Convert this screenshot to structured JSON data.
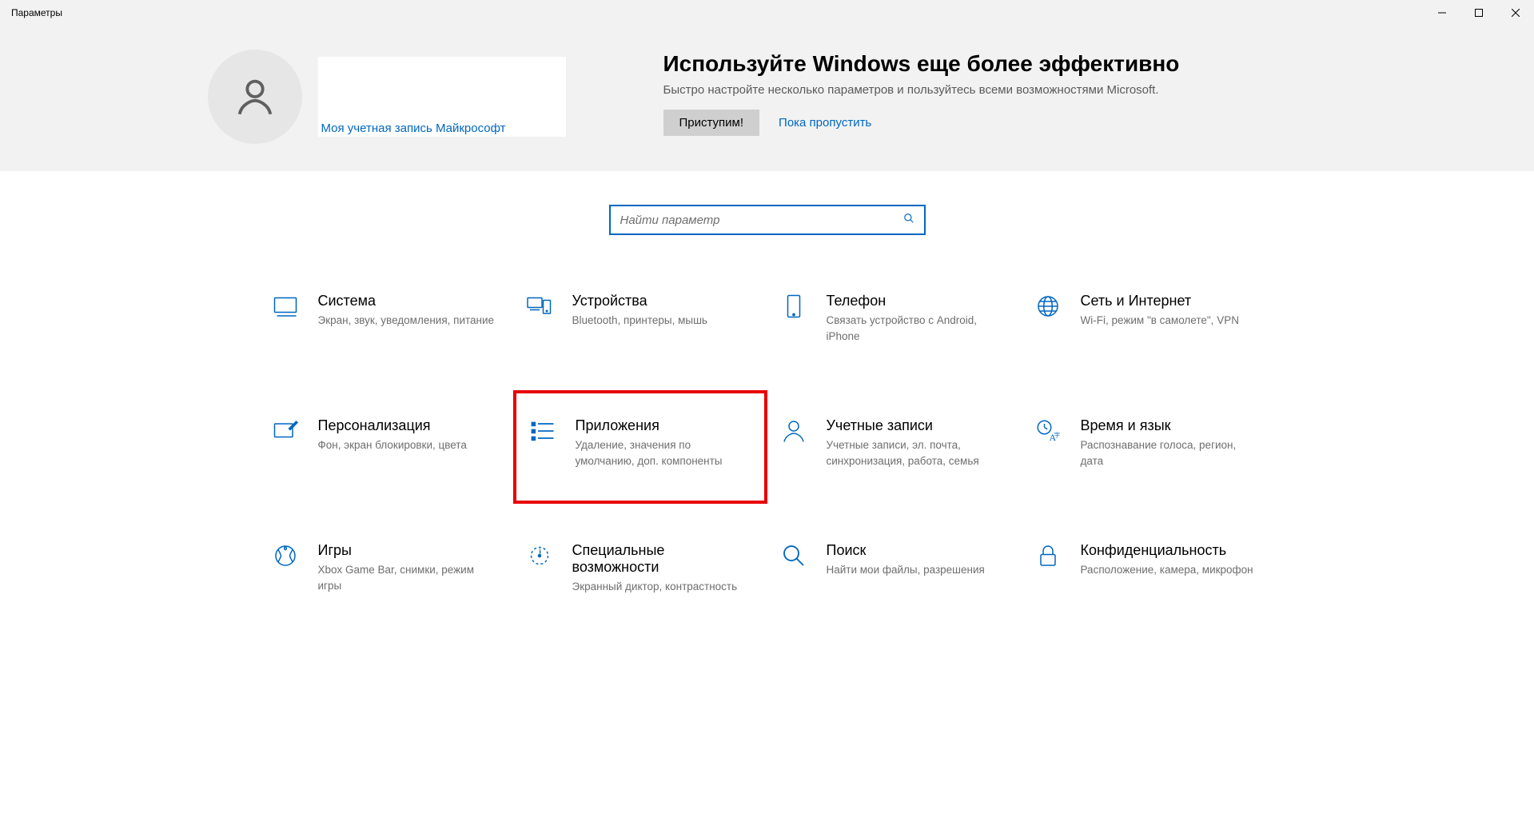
{
  "window": {
    "title": "Параметры"
  },
  "banner": {
    "microsoft_link": "Моя учетная запись Майкрософт",
    "promo_title": "Используйте Windows еще более эффективно",
    "promo_subtitle": "Быстро настройте несколько параметров и пользуйтесь всеми возможностями Microsoft.",
    "cta_primary": "Приступим!",
    "cta_secondary": "Пока пропустить"
  },
  "search": {
    "placeholder": "Найти параметр"
  },
  "categories": [
    {
      "id": "system",
      "title": "Система",
      "desc": "Экран, звук, уведомления, питание"
    },
    {
      "id": "devices",
      "title": "Устройства",
      "desc": "Bluetooth, принтеры, мышь"
    },
    {
      "id": "phone",
      "title": "Телефон",
      "desc": "Связать устройство с Android, iPhone"
    },
    {
      "id": "network",
      "title": "Сеть и Интернет",
      "desc": "Wi-Fi, режим \"в самолете\", VPN"
    },
    {
      "id": "personalization",
      "title": "Персонализация",
      "desc": "Фон, экран блокировки, цвета"
    },
    {
      "id": "apps",
      "title": "Приложения",
      "desc": "Удаление, значения по умолчанию, доп. компоненты",
      "highlight": true
    },
    {
      "id": "accounts",
      "title": "Учетные записи",
      "desc": "Учетные записи, эл. почта, синхронизация, работа, семья"
    },
    {
      "id": "time",
      "title": "Время и язык",
      "desc": "Распознавание голоса, регион, дата"
    },
    {
      "id": "gaming",
      "title": "Игры",
      "desc": "Xbox Game Bar, снимки, режим игры"
    },
    {
      "id": "ease",
      "title": "Специальные возможности",
      "desc": "Экранный диктор, контрастность"
    },
    {
      "id": "searchcat",
      "title": "Поиск",
      "desc": "Найти мои файлы, разрешения"
    },
    {
      "id": "privacy",
      "title": "Конфиденциальность",
      "desc": "Расположение, камера, микрофон"
    }
  ]
}
